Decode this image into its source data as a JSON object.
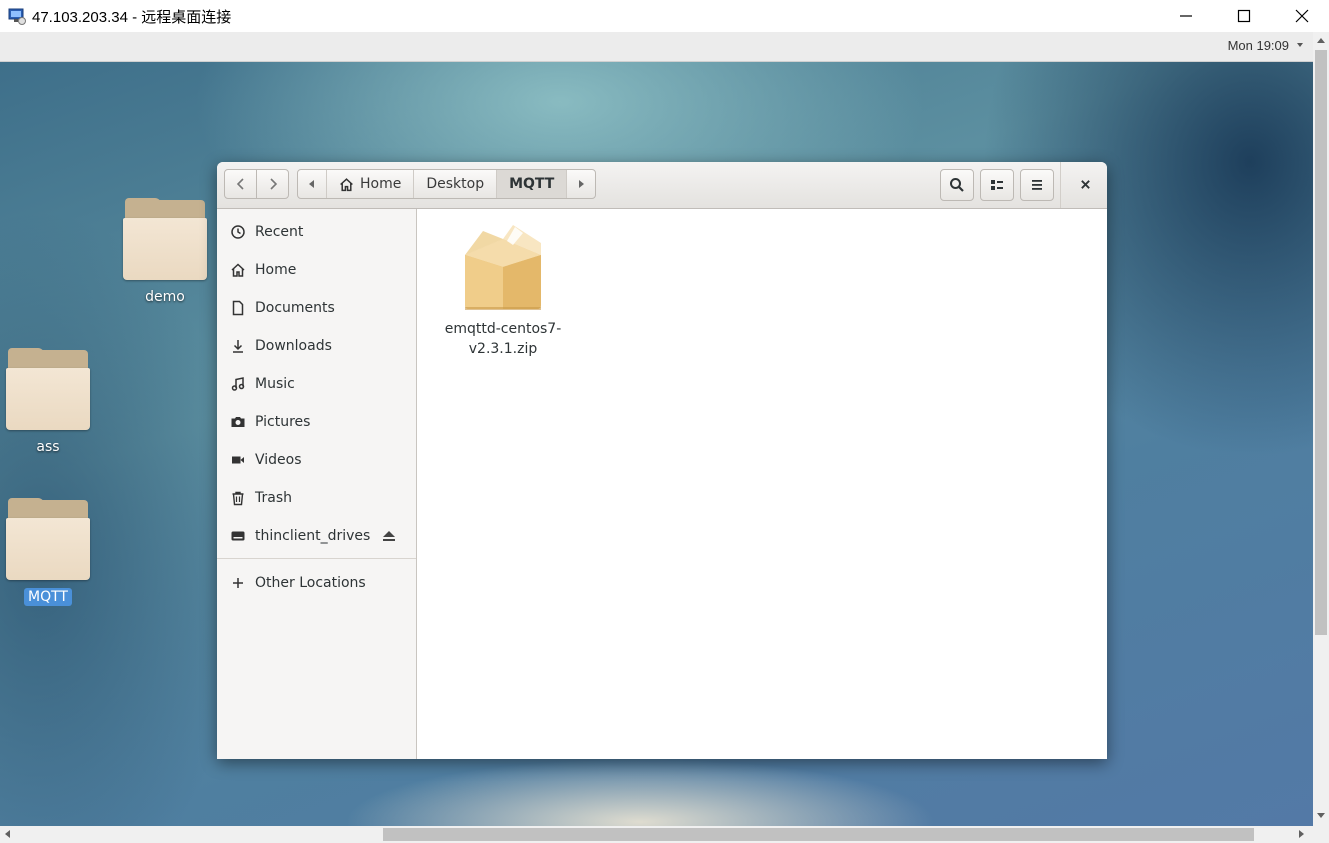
{
  "rdp": {
    "title": "47.103.203.34 - 远程桌面连接"
  },
  "topbar": {
    "clock": "Mon 19:09"
  },
  "desktop": {
    "icons": [
      {
        "label": "demo",
        "selected": false
      },
      {
        "label": "ass",
        "selected": false
      },
      {
        "label": "MQTT",
        "selected": true
      }
    ]
  },
  "nautilus": {
    "path": [
      "Home",
      "Desktop",
      "MQTT"
    ],
    "sidebar": [
      {
        "label": "Recent",
        "icon": "clock-icon"
      },
      {
        "label": "Home",
        "icon": "home-icon"
      },
      {
        "label": "Documents",
        "icon": "document-icon"
      },
      {
        "label": "Downloads",
        "icon": "download-icon"
      },
      {
        "label": "Music",
        "icon": "music-icon"
      },
      {
        "label": "Pictures",
        "icon": "camera-icon"
      },
      {
        "label": "Videos",
        "icon": "video-icon"
      },
      {
        "label": "Trash",
        "icon": "trash-icon"
      },
      {
        "label": "thinclient_drives",
        "icon": "drive-icon"
      },
      {
        "label": "Other Locations",
        "icon": "plus-icon"
      }
    ],
    "files": [
      {
        "line1": "emqttd-centos7-",
        "line2": "v2.3.1.zip",
        "icon": "archive-icon"
      }
    ]
  },
  "colors": {
    "selection": "#4a90d9",
    "folder_front": "#f3e6d4",
    "folder_back": "#c5b190"
  }
}
